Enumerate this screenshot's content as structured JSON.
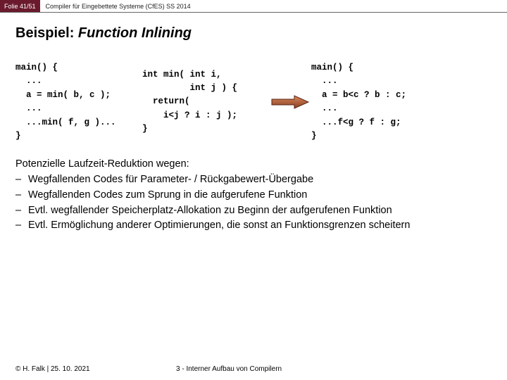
{
  "header": {
    "slide_number": "Folie 41/51",
    "course": "Compiler für Eingebettete Systeme (CfES) SS 2014"
  },
  "title": {
    "prefix": "Beispiel: ",
    "emph": "Function Inlining"
  },
  "code": {
    "left": "main() {\n  ...\n  a = min( b, c );\n  ...\n  ...min( f, g )...\n}",
    "mid": "int min( int i,\n         int j ) {\n  return(\n    i<j ? i : j );\n}",
    "right": "main() {\n  ...\n  a = b<c ? b : c;\n  ...\n  ...f<g ? f : g;\n}"
  },
  "body": {
    "intro": "Potenzielle Laufzeit-Reduktion wegen:",
    "items": [
      "Wegfallenden Codes für Parameter- / Rückgabewert-Übergabe",
      "Wegfallenden Codes zum Sprung in die aufgerufene Funktion",
      "Evtl. wegfallender Speicherplatz-Allokation zu Beginn der aufgerufenen Funktion",
      "Evtl. Ermöglichung anderer Optimierungen, die sonst an Funktionsgrenzen scheitern"
    ]
  },
  "footer": {
    "left": "© H. Falk | 25. 10. 2021",
    "center": "3 - Interner Aufbau von Compilern"
  },
  "colors": {
    "brand": "#6b1a2e",
    "arrow_fill": "#b55a3a",
    "arrow_stroke": "#5a2416"
  }
}
